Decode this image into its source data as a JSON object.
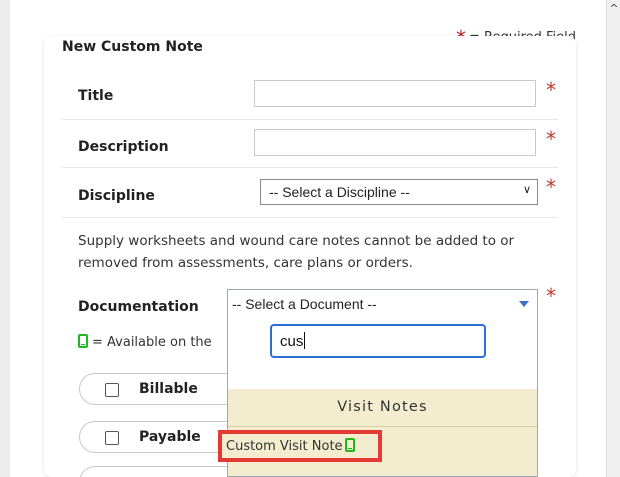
{
  "required_note": {
    "star": "*",
    "text": "= Required Field"
  },
  "form": {
    "title": "New Custom Note",
    "fields": {
      "title_label": "Title",
      "description_label": "Description",
      "discipline_label": "Discipline",
      "discipline_value": "-- Select a Discipline --",
      "documentation_label": "Documentation",
      "documentation_value": "-- Select a Document --",
      "required_star": "*"
    },
    "info_text": "Supply worksheets and wound care notes cannot be added to or removed from assessments, care plans or orders.",
    "legend_text": "= Available on the",
    "checkboxes": [
      {
        "label": "Billable",
        "checked": false
      },
      {
        "label": "Payable",
        "checked": false
      }
    ]
  },
  "dropdown": {
    "search_value": "cus",
    "group_label": "Visit Notes",
    "options": [
      {
        "label": "Custom Visit Note",
        "icon": "mobile-icon",
        "highlighted": true
      }
    ]
  },
  "colors": {
    "required": "#c0392b",
    "dropdown_bg": "#f3eccf",
    "highlight_border": "#e53935",
    "mobile_icon": "#1fb81f",
    "focus_border": "#2d6fd8"
  }
}
